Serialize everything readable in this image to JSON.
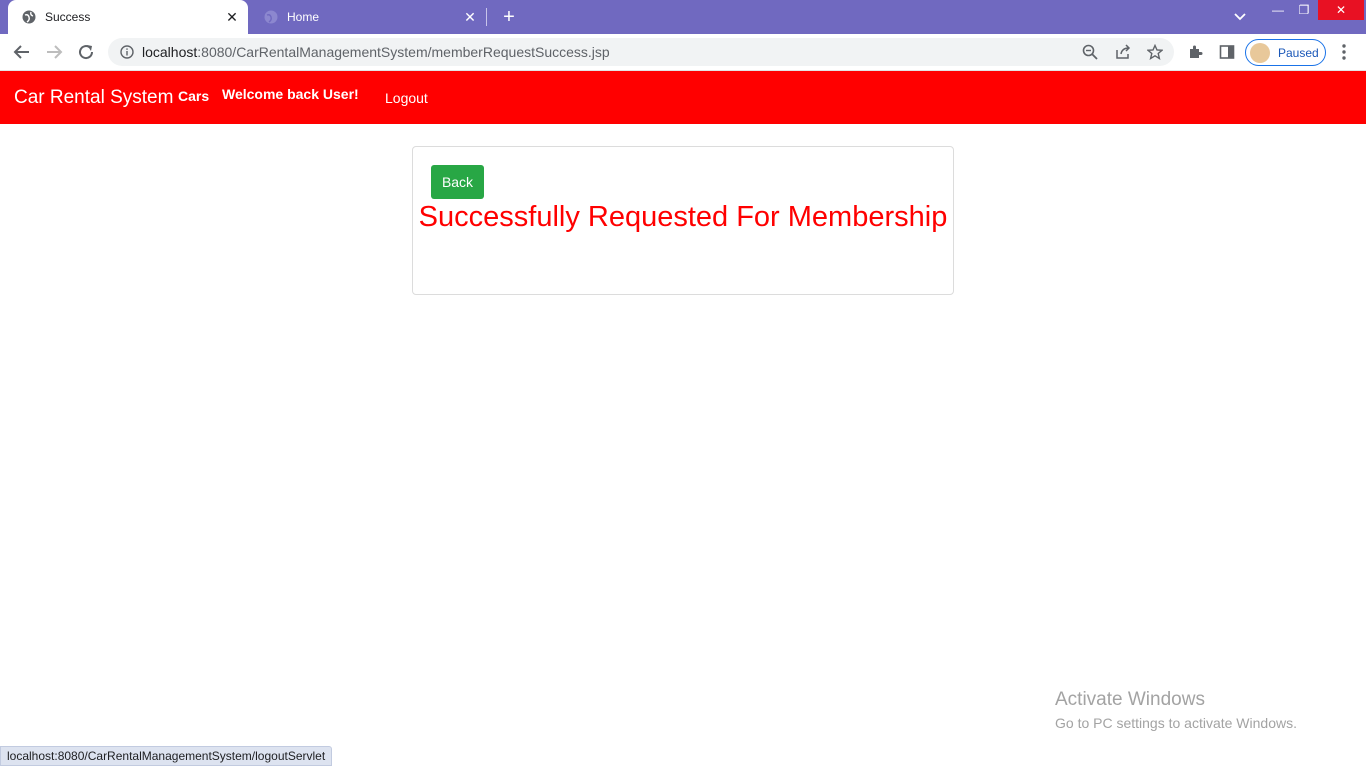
{
  "browser": {
    "tabs": [
      {
        "title": "Success",
        "active": true
      },
      {
        "title": "Home",
        "active": false
      }
    ],
    "url": {
      "host": "localhost",
      "path": ":8080/CarRentalManagementSystem/memberRequestSuccess.jsp"
    },
    "profile_label": "Paused",
    "status_url": "localhost:8080/CarRentalManagementSystem/logoutServlet",
    "accent_color": "#7069c0"
  },
  "navbar": {
    "brand": "Car Rental System",
    "cars": "Cars",
    "welcome": "Welcome back User!",
    "logout": "Logout",
    "color": "#ff0000"
  },
  "card": {
    "back_label": "Back",
    "message": "Successfully Requested For Membership"
  },
  "watermark": {
    "title": "Activate Windows",
    "subtitle": "Go to PC settings to activate Windows."
  }
}
